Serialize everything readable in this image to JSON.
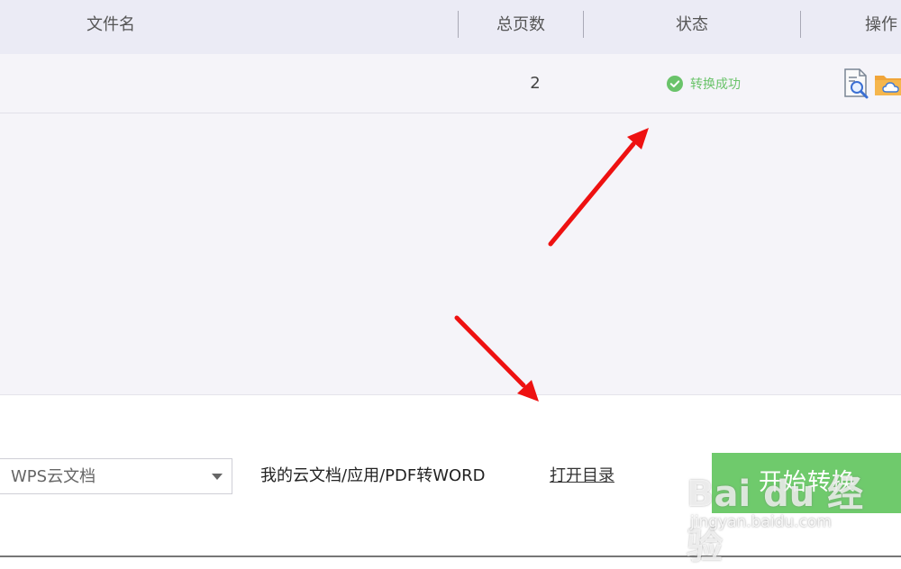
{
  "table": {
    "headers": {
      "filename": "文件名",
      "pages": "总页数",
      "status": "状态",
      "actions": "操作"
    },
    "rows": [
      {
        "filename": "",
        "pages": "2",
        "status": "转换成功"
      }
    ]
  },
  "output": {
    "location_select": "WPS云文档",
    "path": "我的云文档/应用/PDF转WORD",
    "open_dir_label": "打开目录",
    "start_button_label": "开始转换"
  },
  "watermark": {
    "logo_text": "Bai du 经验",
    "site": "jingyan.baidu.com"
  },
  "colors": {
    "header_bg": "#ebebf5",
    "body_bg": "#f5f4f9",
    "success_green": "#6ac36a",
    "button_green": "#6fca6c",
    "annotation_red": "#ee1111",
    "folder_orange": "#f0a53a"
  },
  "icons": {
    "status": "check-circle-icon",
    "preview": "preview-document-icon",
    "open_folder": "cloud-folder-icon",
    "dropdown": "caret-down-icon"
  }
}
